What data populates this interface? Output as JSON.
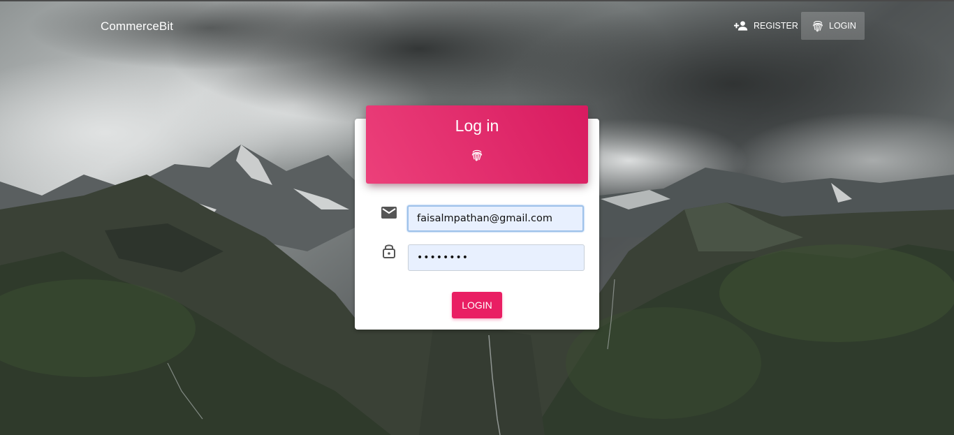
{
  "navbar": {
    "brand": "CommerceBit",
    "register_label": "REGISTER",
    "register_icon": "person-add-icon",
    "login_label": "LOGIN",
    "login_icon": "fingerprint-icon"
  },
  "login_card": {
    "title": "Log in",
    "header_icon": "fingerprint-icon",
    "email_icon": "mail-icon",
    "email_value": "faisalmpathan@gmail.com",
    "password_icon": "lock-icon",
    "password_value": "••••••••",
    "submit_label": "LOGIN"
  },
  "colors": {
    "accent": "#e91e63",
    "header_gradient_start": "#ec407a",
    "header_gradient_end": "#d81b60",
    "input_background": "#e8f0fe"
  }
}
